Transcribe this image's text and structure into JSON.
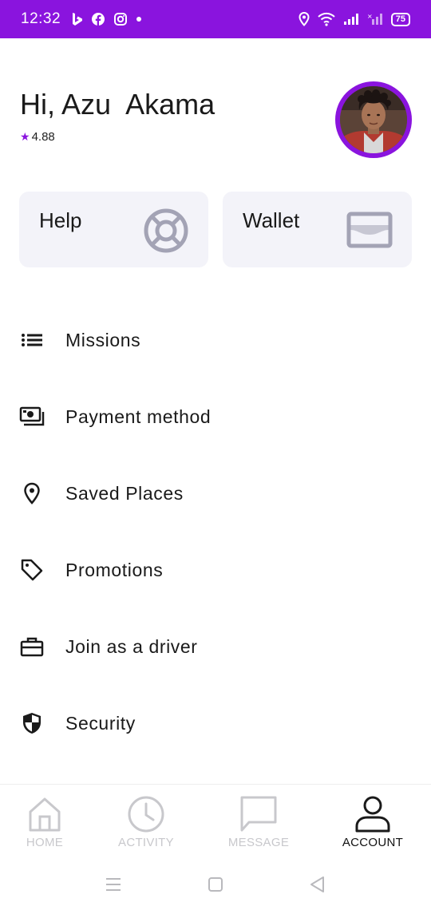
{
  "status_bar": {
    "time": "12:32",
    "battery": "75",
    "left_icons": [
      "bing-icon",
      "facebook-icon",
      "instagram-icon",
      "dot-icon"
    ],
    "right_icons": [
      "location-icon",
      "wifi-icon",
      "signal-icon",
      "signal-no-sim-icon",
      "battery-icon"
    ],
    "background": "#8a14de"
  },
  "header": {
    "greeting": "Hi, Azu  Akama",
    "rating_star": "★",
    "rating": "4.88"
  },
  "cards": {
    "help": {
      "label": "Help",
      "icon": "lifebuoy-icon"
    },
    "wallet": {
      "label": "Wallet",
      "icon": "wallet-icon"
    }
  },
  "menu": [
    {
      "label": "Missions",
      "icon": "list-icon"
    },
    {
      "label": "Payment method",
      "icon": "cash-icon"
    },
    {
      "label": "Saved Places",
      "icon": "location-pin-icon"
    },
    {
      "label": "Promotions",
      "icon": "tag-icon"
    },
    {
      "label": "Join as a driver",
      "icon": "briefcase-icon"
    },
    {
      "label": "Security",
      "icon": "shield-icon"
    }
  ],
  "bottom_nav": [
    {
      "label": "HOME",
      "icon": "home-icon",
      "active": false
    },
    {
      "label": "ACTIVITY",
      "icon": "clock-icon",
      "active": false
    },
    {
      "label": "MESSAGE",
      "icon": "chat-icon",
      "active": false
    },
    {
      "label": "ACCOUNT",
      "icon": "user-icon",
      "active": true
    }
  ],
  "colors": {
    "accent": "#8a14de",
    "card_bg": "#f3f3f9",
    "inactive": "#c8c8cc"
  }
}
